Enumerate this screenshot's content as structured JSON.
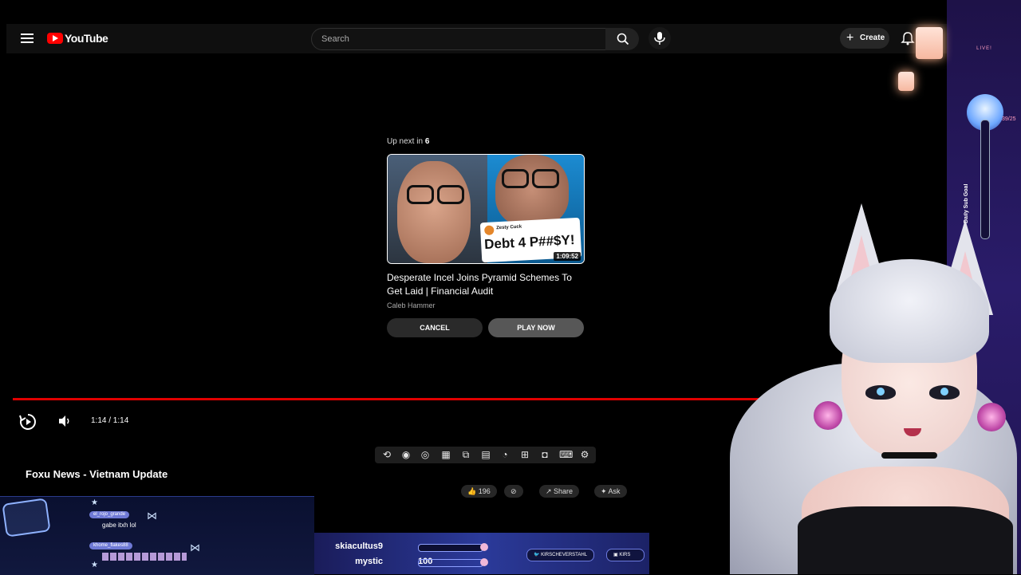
{
  "header": {
    "logo_text": "YouTube",
    "search_placeholder": "Search",
    "create_label": "Create"
  },
  "endscreen": {
    "upnext_prefix": "Up next in ",
    "countdown": "6",
    "thumbnail": {
      "tweet_name": "Zesty Cuck",
      "tweet_text": "Debt 4 P##$Y!",
      "duration": "1:09:52"
    },
    "title": "Desperate Incel Joins Pyramid Schemes To Get Laid | Financial Audit",
    "channel": "Caleb Hammer",
    "cancel_label": "CANCEL",
    "play_label": "PLAY NOW"
  },
  "player": {
    "time": "1:14 / 1:14",
    "progress_fraction": 1.0,
    "accent": "#e00000"
  },
  "video": {
    "title": "Foxu News - Vietnam Update",
    "like_count": "196",
    "share_label": "Share",
    "ask_label": "Ask"
  },
  "overlay": {
    "chat": [
      {
        "user": "el_rojo_grande",
        "message": "gabe itxh lol"
      },
      {
        "user": "khome_flakes88",
        "message": ""
      }
    ],
    "stats": [
      {
        "name": "skiacultus9",
        "value": ""
      },
      {
        "name": "mystic",
        "value": "100"
      }
    ],
    "socials": [
      "KIRSCHEVERSTAHL",
      "KIRS"
    ],
    "live_badge": "LIVE!",
    "goal_label": "Daily Sub Goal",
    "goal_count": "39/25"
  }
}
